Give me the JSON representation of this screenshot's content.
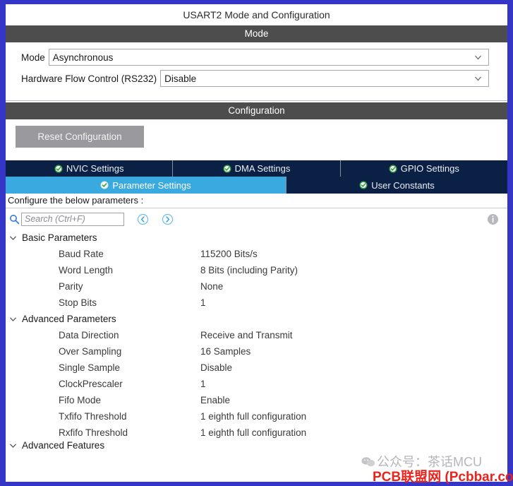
{
  "window": {
    "title": "USART2 Mode and Configuration"
  },
  "colors": {
    "frame_border": "#3535c8",
    "section_header_bg": "#4d4d4d",
    "tab_inactive_bg": "#0b2045",
    "tab_active_bg": "#3aa9e0",
    "reset_button_bg": "#9a9a9e",
    "check_green": "#3aa649",
    "accent_blue": "#3aa9e0",
    "watermark_red": "#e8241d",
    "watermark_gray": "#b5b5bb"
  },
  "mode_section": {
    "header": "Mode",
    "fields": [
      {
        "label": "Mode",
        "value": "Asynchronous",
        "icon": "chevron-down-icon"
      },
      {
        "label": "Hardware Flow Control (RS232)",
        "value": "Disable",
        "icon": "chevron-down-icon"
      }
    ]
  },
  "configuration_section": {
    "header": "Configuration",
    "reset_button": "Reset Configuration",
    "tabs_row1": [
      {
        "label": "NVIC Settings",
        "active": false
      },
      {
        "label": "DMA Settings",
        "active": false
      },
      {
        "label": "GPIO Settings",
        "active": false
      }
    ],
    "tabs_row2": [
      {
        "label": "Parameter Settings",
        "active": true
      },
      {
        "label": "User Constants",
        "active": false
      }
    ]
  },
  "parameters_panel": {
    "hint": "Configure the below parameters :",
    "search": {
      "placeholder": "Search (Ctrl+F)",
      "value": "",
      "icon": "search-icon"
    },
    "nav_prev_icon": "circle-chevron-left-icon",
    "nav_next_icon": "circle-chevron-right-icon",
    "info_icon": "info-icon",
    "groups": [
      {
        "name": "Basic Parameters",
        "expanded": true,
        "rows": [
          {
            "name": "Baud Rate",
            "value": "115200 Bits/s"
          },
          {
            "name": "Word Length",
            "value": "8 Bits (including Parity)"
          },
          {
            "name": "Parity",
            "value": "None"
          },
          {
            "name": "Stop Bits",
            "value": "1"
          }
        ]
      },
      {
        "name": "Advanced Parameters",
        "expanded": true,
        "rows": [
          {
            "name": "Data Direction",
            "value": "Receive and Transmit"
          },
          {
            "name": "Over Sampling",
            "value": "16 Samples"
          },
          {
            "name": "Single Sample",
            "value": "Disable"
          },
          {
            "name": "ClockPrescaler",
            "value": "1"
          },
          {
            "name": "Fifo Mode",
            "value": "Enable"
          },
          {
            "name": "Txfifo Threshold",
            "value": "1 eighth full configuration"
          },
          {
            "name": "Rxfifo Threshold",
            "value": "1 eighth full configuration"
          }
        ]
      },
      {
        "name": "Advanced Features",
        "expanded": true,
        "clipped": true,
        "rows": []
      }
    ]
  },
  "watermarks": {
    "gray": "公众号：茶话MCU",
    "red": "PCB联盟网 (Pcbbar.com)"
  }
}
